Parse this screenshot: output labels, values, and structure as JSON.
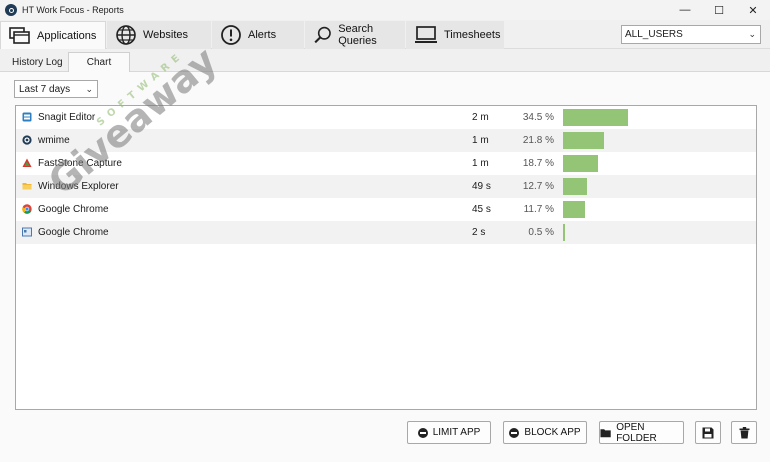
{
  "window": {
    "title": "HT Work Focus - Reports",
    "controls": [
      "—",
      "☐",
      "✕"
    ]
  },
  "tabs": [
    {
      "label": "Applications",
      "icon": "window-stack-icon"
    },
    {
      "label": "Websites",
      "icon": "globe-icon"
    },
    {
      "label": "Alerts",
      "icon": "alert-circle-icon"
    },
    {
      "label": "Search Queries",
      "icon": "magnifier-icon"
    },
    {
      "label": "Timesheets",
      "icon": "laptop-icon"
    }
  ],
  "user_filter": {
    "value": "ALL_USERS"
  },
  "subtabs": [
    "History Log",
    "Chart"
  ],
  "period": {
    "value": "Last 7 days"
  },
  "rows": [
    {
      "name": "Snagit Editor",
      "duration": "2 m",
      "percent": "34.5 %",
      "share": 34.5,
      "icon": "snagit-icon"
    },
    {
      "name": "wmime",
      "duration": "1 m",
      "percent": "21.8 %",
      "share": 21.8,
      "icon": "ht-app-icon"
    },
    {
      "name": "FastStone Capture",
      "duration": "1 m",
      "percent": "18.7 %",
      "share": 18.7,
      "icon": "faststone-icon"
    },
    {
      "name": "Windows Explorer",
      "duration": "49 s",
      "percent": "12.7 %",
      "share": 12.7,
      "icon": "folder-icon"
    },
    {
      "name": "Google Chrome",
      "duration": "45 s",
      "percent": "11.7 %",
      "share": 11.7,
      "icon": "chrome-icon"
    },
    {
      "name": "Google Chrome",
      "duration": "2 s",
      "percent": "0.5 %",
      "share": 0.5,
      "icon": "app-window-icon"
    }
  ],
  "buttons": {
    "limit": "LIMIT APP",
    "block": "BLOCK APP",
    "open_folder": "OPEN FOLDER"
  },
  "watermark": {
    "text": "Giveaway",
    "sub": "SOFTWARE"
  },
  "colors": {
    "bar": "#94c576",
    "accent": "#1f3b57"
  }
}
